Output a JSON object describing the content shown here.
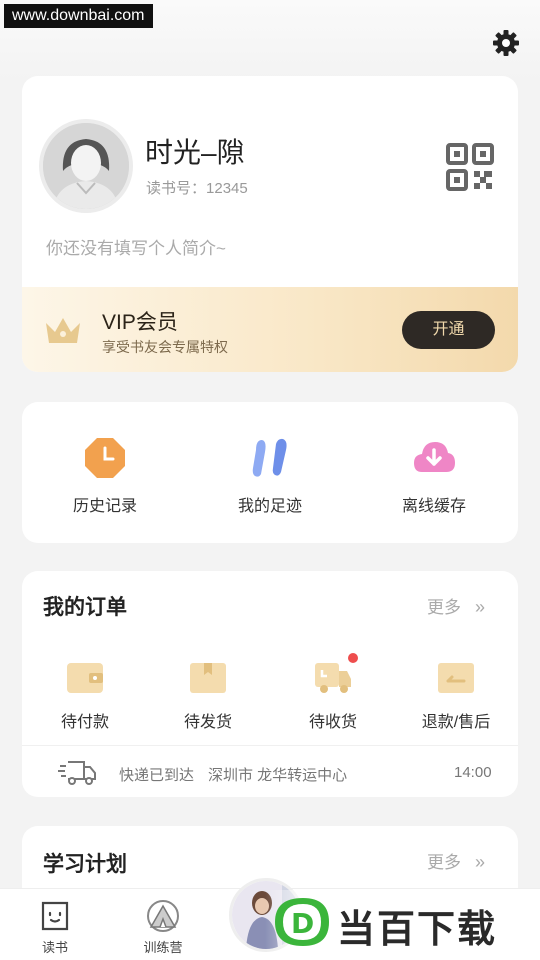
{
  "watermark": "www.downbai.com",
  "profile": {
    "nickname": "时光–隙",
    "uid_label": "读书号：",
    "uid": "12345",
    "intro": "你还没有填写个人简介~"
  },
  "vip": {
    "title": "VIP会员",
    "subtitle": "享受书友会专属特权",
    "button": "开通"
  },
  "quick_actions": [
    {
      "label": "历史记录",
      "icon": "clock-icon",
      "color": "#f2a14e"
    },
    {
      "label": "我的足迹",
      "icon": "footprints-icon",
      "color": "#7b9cf0"
    },
    {
      "label": "离线缓存",
      "icon": "cloud-download-icon",
      "color": "#ee82c4"
    }
  ],
  "orders": {
    "title": "我的订单",
    "more": "更多",
    "chevron": "»",
    "items": [
      {
        "label": "待付款",
        "icon": "wallet-icon"
      },
      {
        "label": "待发货",
        "icon": "box-icon"
      },
      {
        "label": "待收货",
        "icon": "truck-icon",
        "badge": true
      },
      {
        "label": "退款/售后",
        "icon": "refund-icon"
      }
    ],
    "tracking": {
      "status": "快递已到达",
      "location": "深圳市 龙华转运中心",
      "time": "14:00"
    }
  },
  "study": {
    "title": "学习计划",
    "more": "更多",
    "chevron": "»"
  },
  "tabbar": [
    {
      "label": "读书",
      "icon": "book-icon"
    },
    {
      "label": "训练营",
      "icon": "camp-icon"
    }
  ],
  "brand": {
    "text": "当百下载",
    "logo_letter": "D"
  },
  "colors": {
    "accent_gold": "#f1d9ac",
    "vip_button": "#2e2925",
    "badge_red": "#ee4d4d",
    "brand_green": "#3bb53b"
  }
}
